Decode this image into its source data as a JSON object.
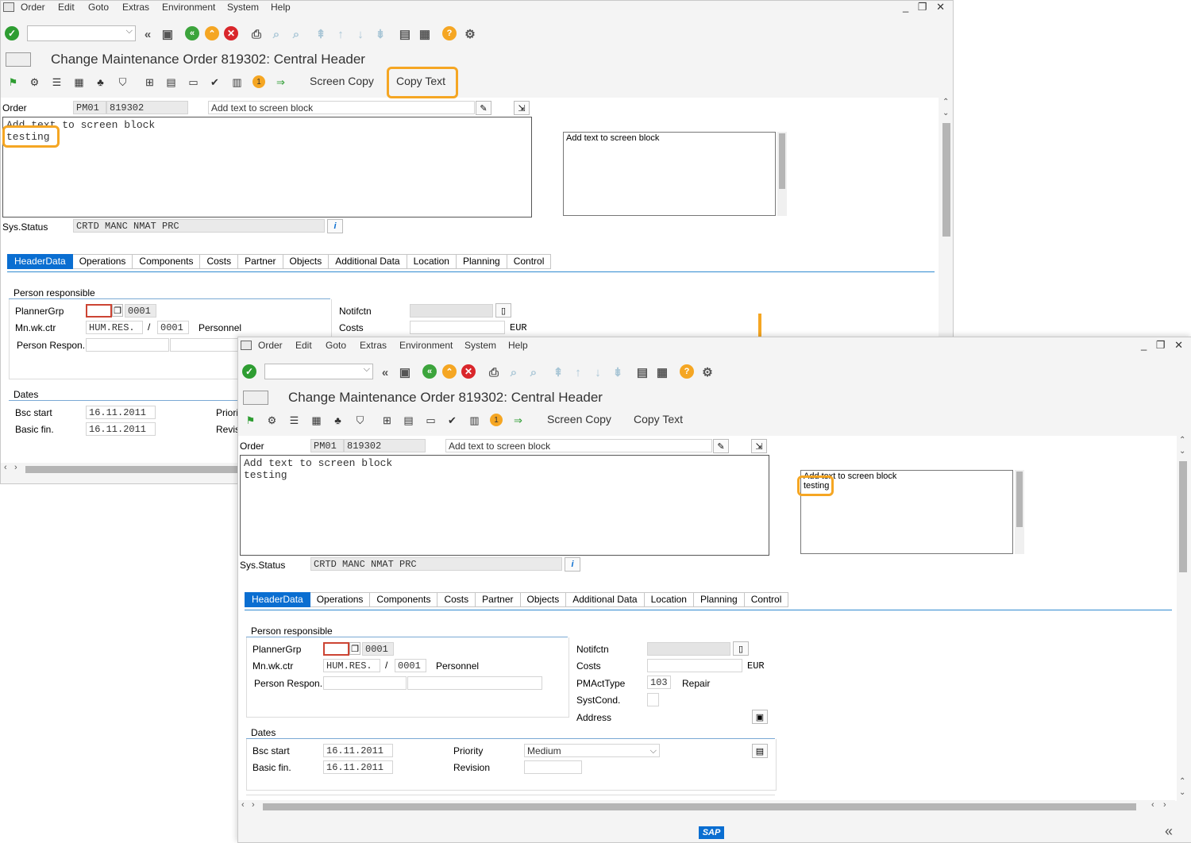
{
  "menu": {
    "items": [
      "Order",
      "Edit",
      "Goto",
      "Extras",
      "Environment",
      "System",
      "Help"
    ]
  },
  "window_controls": "_ ❐ ✕",
  "screen1": {
    "title": "Change Maintenance Order 819302: Central Header",
    "app_toolbar": {
      "screen_copy": "Screen Copy",
      "copy_text": "Copy Text"
    },
    "order_label": "Order",
    "order_type": "PM01",
    "order_number": "819302",
    "short_text": "Add text to screen block",
    "long_text_lines": [
      "Add text to screen block",
      "testing"
    ],
    "mini_box_text": "Add text to screen block",
    "sys_status_label": "Sys.Status",
    "sys_status": "CRTD MANC NMAT PRC",
    "tabs": [
      "HeaderData",
      "Operations",
      "Components",
      "Costs",
      "Partner",
      "Objects",
      "Additional Data",
      "Location",
      "Planning",
      "Control"
    ],
    "person_responsible": "Person responsible",
    "planner_grp_label": "PlannerGrp",
    "planner_grp_value": "0001",
    "mn_wk_ctr_label": "Mn.wk.ctr",
    "mn_wk_ctr_value": "HUM.RES.",
    "mn_wk_ctr_plant": "0001",
    "personnel_label": "Personnel",
    "person_respon_label": "Person Respon.",
    "notifctn_label": "Notifctn",
    "costs_label": "Costs",
    "currency": "EUR",
    "dates_label": "Dates",
    "bsc_start_label": "Bsc start",
    "bsc_start": "16.11.2011",
    "basic_fin_label": "Basic fin.",
    "basic_fin": "16.11.2011",
    "priority_label_cut": "Priorit",
    "revision_label_cut": "Revisi"
  },
  "screen2": {
    "title": "Change Maintenance Order 819302: Central Header",
    "app_toolbar": {
      "screen_copy": "Screen Copy",
      "copy_text": "Copy Text"
    },
    "order_label": "Order",
    "order_type": "PM01",
    "order_number": "819302",
    "short_text": "Add text to screen block",
    "long_text_lines": [
      "Add text to screen block",
      "testing"
    ],
    "mini_box_line1": "Add text to screen block",
    "mini_box_line2": "testing",
    "sys_status_label": "Sys.Status",
    "sys_status": "CRTD MANC NMAT PRC",
    "tabs": [
      "HeaderData",
      "Operations",
      "Components",
      "Costs",
      "Partner",
      "Objects",
      "Additional Data",
      "Location",
      "Planning",
      "Control"
    ],
    "person_responsible": "Person responsible",
    "planner_grp_label": "PlannerGrp",
    "planner_grp_value": "0001",
    "mn_wk_ctr_label": "Mn.wk.ctr",
    "mn_wk_ctr_value": "HUM.RES.",
    "mn_wk_ctr_plant": "0001",
    "personnel_label": "Personnel",
    "person_respon_label": "Person Respon.",
    "notifctn_label": "Notifctn",
    "costs_label": "Costs",
    "currency": "EUR",
    "pm_act_type_label": "PMActType",
    "pm_act_type_value": "103",
    "pm_act_type_text": "Repair",
    "syst_cond_label": "SystCond.",
    "address_label": "Address",
    "dates_label": "Dates",
    "bsc_start_label": "Bsc start",
    "bsc_start": "16.11.2011",
    "basic_fin_label": "Basic fin.",
    "basic_fin": "16.11.2011",
    "priority_label": "Priority",
    "priority_value": "Medium",
    "revision_label": "Revision"
  },
  "footer": {
    "logo": "SAP"
  },
  "colors": {
    "highlight": "#f5a623",
    "tab_active": "#0a6ed1"
  }
}
